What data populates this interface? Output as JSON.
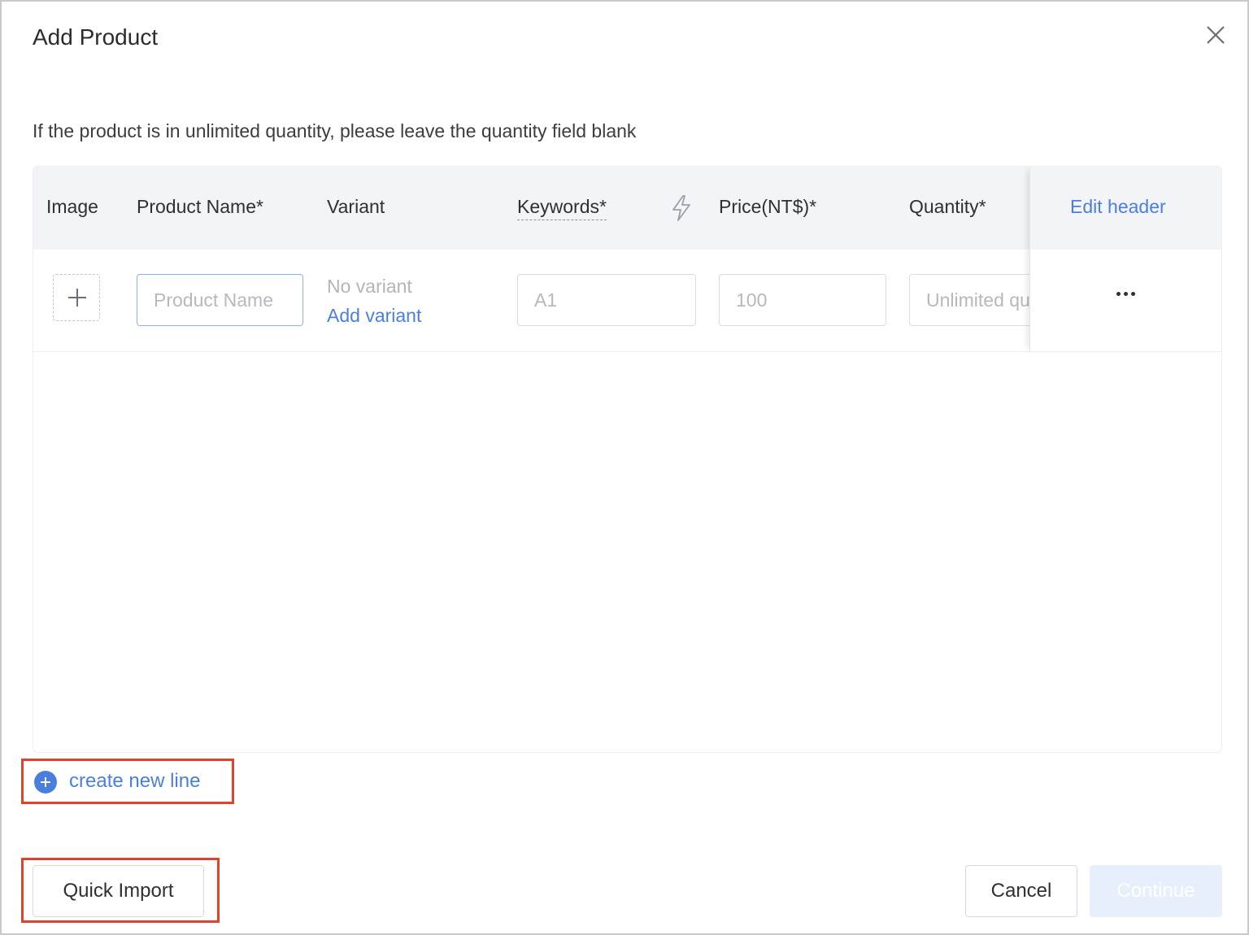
{
  "dialog": {
    "title": "Add Product",
    "notice": "If the product is in unlimited quantity, please leave the quantity field blank"
  },
  "table": {
    "headers": {
      "image": "Image",
      "product_name": "Product Name*",
      "variant": "Variant",
      "keywords": "Keywords*",
      "price": "Price(NT$)*",
      "quantity": "Quantity*",
      "edit_header": "Edit header"
    },
    "row": {
      "product_name_placeholder": "Product Name",
      "no_variant": "No variant",
      "add_variant": "Add variant",
      "keywords_placeholder": "A1",
      "price_placeholder": "100",
      "quantity_placeholder": "Unlimited quantity"
    }
  },
  "actions": {
    "create_new_line": "create new line",
    "quick_import": "Quick Import",
    "cancel": "Cancel",
    "continue": "Continue"
  },
  "colors": {
    "accent": "#4a7fe0",
    "highlight_box": "#e0432c",
    "header_bg": "#f3f4f8",
    "continue_disabled_bg": "#e8effc"
  },
  "icons": {
    "close": "close-icon",
    "bolt": "lightning-icon",
    "upload": "plus-icon",
    "more": "more-horizontal-icon",
    "add_line": "plus-circle-icon"
  }
}
